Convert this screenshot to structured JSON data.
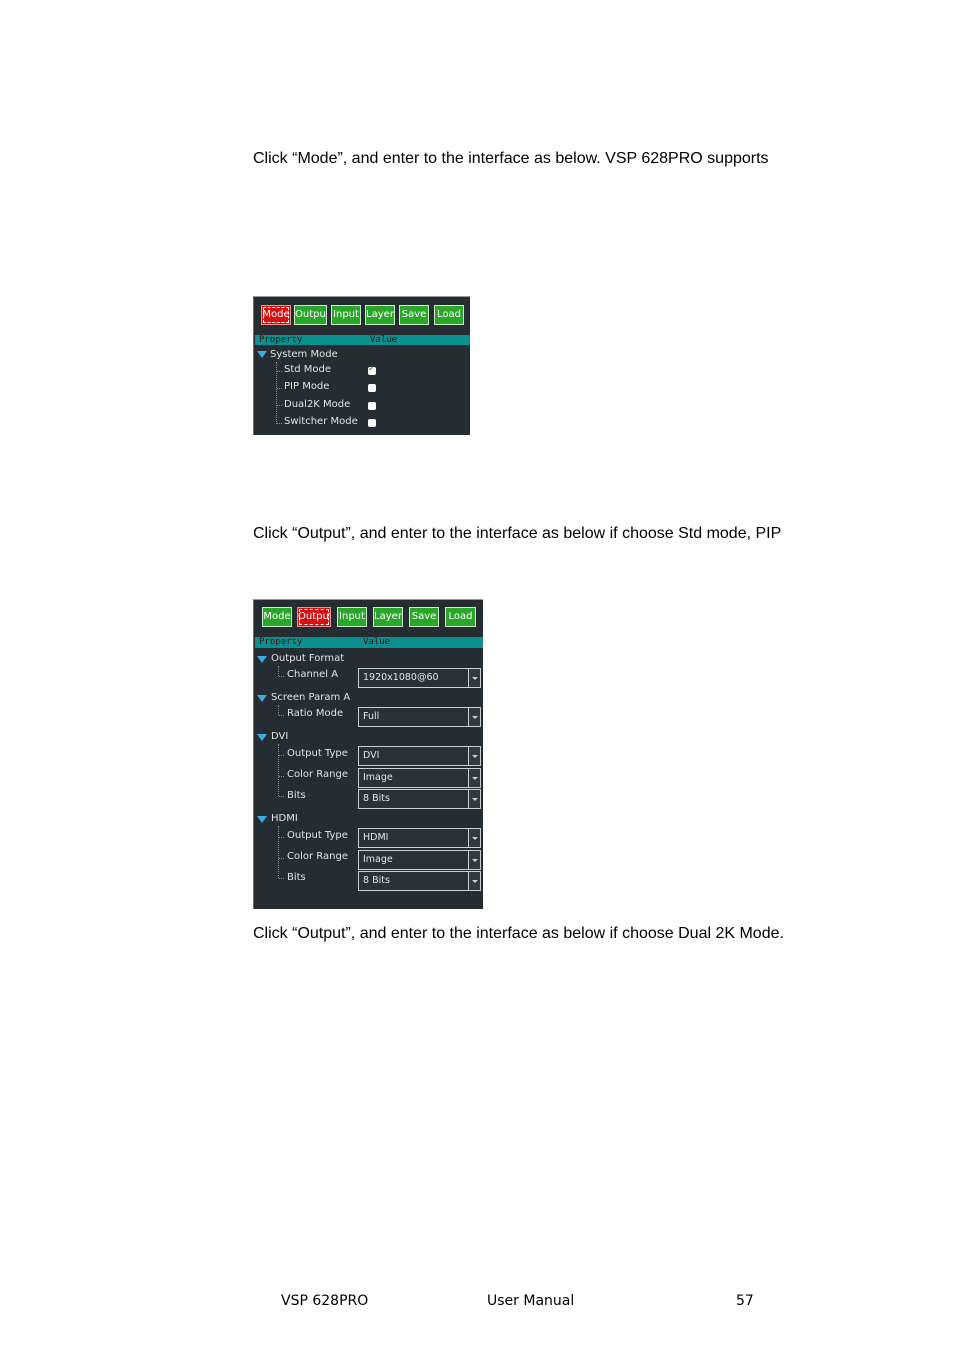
{
  "paragraphs": {
    "p1": "Click “Mode”, and enter to the interface as below. VSP 628PRO supports",
    "p2": "Click “Output”, and enter to the interface as below if choose Std mode, PIP",
    "p3": "Click “Output”, and enter to the interface as below if choose Dual 2K Mode."
  },
  "toolbar": {
    "mode": "Mode",
    "output": "Output",
    "input": "Input",
    "layer": "Layer",
    "save": "Save",
    "load": "Load"
  },
  "table_header": {
    "property": "Property",
    "value": "Value"
  },
  "mode_panel": {
    "group": "System Mode",
    "items": [
      {
        "label": "Std Mode",
        "checked": true
      },
      {
        "label": "PIP Mode",
        "checked": false
      },
      {
        "label": "Dual2K Mode",
        "checked": false
      },
      {
        "label": "Switcher Mode",
        "checked": false
      }
    ]
  },
  "output_panel": {
    "output_format": {
      "group": "Output Format",
      "channel_a_label": "Channel A",
      "channel_a_value": "1920x1080@60"
    },
    "screen_param": {
      "group": "Screen Param A",
      "ratio_mode_label": "Ratio Mode",
      "ratio_mode_value": "Full"
    },
    "dvi": {
      "group": "DVI",
      "output_type_label": "Output Type",
      "output_type_value": "DVI",
      "color_range_label": "Color Range",
      "color_range_value": "Image",
      "bits_label": "Bits",
      "bits_value": "8 Bits"
    },
    "hdmi": {
      "group": "HDMI",
      "output_type_label": "Output Type",
      "output_type_value": "HDMI",
      "color_range_label": "Color Range",
      "color_range_value": "Image",
      "bits_label": "Bits",
      "bits_value": "8 Bits"
    }
  },
  "footer": {
    "product": "VSP 628PRO",
    "doc": "User Manual",
    "page": "57"
  },
  "colors": {
    "panel_bg": "#262d32",
    "button_green": "#2aa72a",
    "button_active_red": "#d41010",
    "header_teal": "#0c8f8f",
    "tree_triangle": "#3fa9e0"
  }
}
